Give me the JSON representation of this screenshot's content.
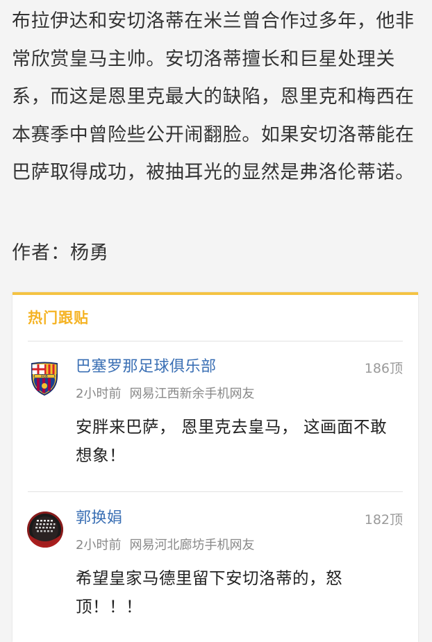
{
  "article": {
    "body": "布拉伊达和安切洛蒂在米兰曾合作过多年，他非常欣赏皇马主帅。安切洛蒂擅长和巨星处理关系，而这是恩里克最大的缺陷，恩里克和梅西在本赛季中曾险些公开闹翻脸。如果安切洛蒂能在巴萨取得成功，被抽耳光的显然是弗洛伦蒂诺。",
    "author": "作者：杨勇"
  },
  "hot_comments": {
    "title": "热门跟贴",
    "accent_color": "#f4c343",
    "items": [
      {
        "user": "巴塞罗那足球俱乐部",
        "votes": "186顶",
        "time": "2小时前",
        "location": "网易江西新余手机网友",
        "text": "安胖来巴萨， 恩里克去皇马， 这画面不敢想象！",
        "avatar_icon": "fc-barcelona-crest-icon",
        "avatar_text": "FCB"
      },
      {
        "user": "郭换娟",
        "votes": "182顶",
        "time": "2小时前",
        "location": "网易河北廊坊手机网友",
        "text": "希望皇家马德里留下安切洛蒂的，怒顶！！！",
        "avatar_icon": "user-avatar-photo-icon"
      }
    ]
  }
}
